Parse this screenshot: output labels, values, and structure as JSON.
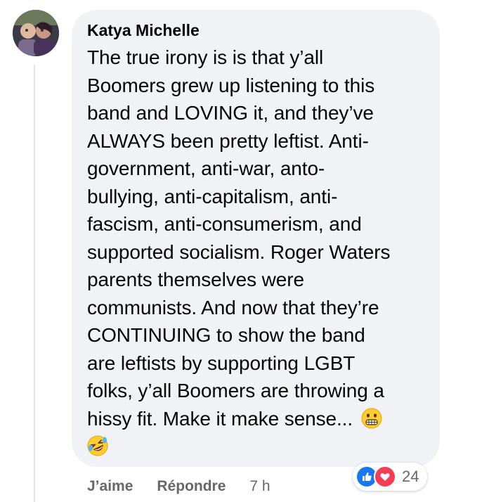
{
  "comment": {
    "author": "Katya Michelle",
    "text_lines": [
      "The true irony is is that y’all",
      "Boomers grew up listening to this",
      "band and LOVING it, and they’ve",
      "ALWAYS been pretty leftist. Anti-",
      "government, anti-war, anto-",
      "bullying, anti-capitalism, anti-",
      "fascism, anti-consumerism, and",
      "supported socialism. Roger Waters",
      "parents themselves were",
      "communists. And now that they’re",
      "CONTINUING to show the band",
      "are leftists by supporting LGBT",
      "folks, y’all Boomers are throwing a",
      "hissy fit. Make it make sense..."
    ],
    "emojis": [
      "grimacing-face-icon",
      "rolling-on-floor-laughing-icon"
    ],
    "reactions": {
      "types": [
        "like-icon",
        "love-icon"
      ],
      "count": "24"
    },
    "actions": {
      "like": "J’aime",
      "reply": "Répondre",
      "time": "7 h"
    }
  },
  "colors": {
    "bubble": "#f0f2f5",
    "text": "#050505",
    "secondary_text": "#65676b",
    "like_blue": "#1877f2",
    "love_red": "#f33e58"
  }
}
